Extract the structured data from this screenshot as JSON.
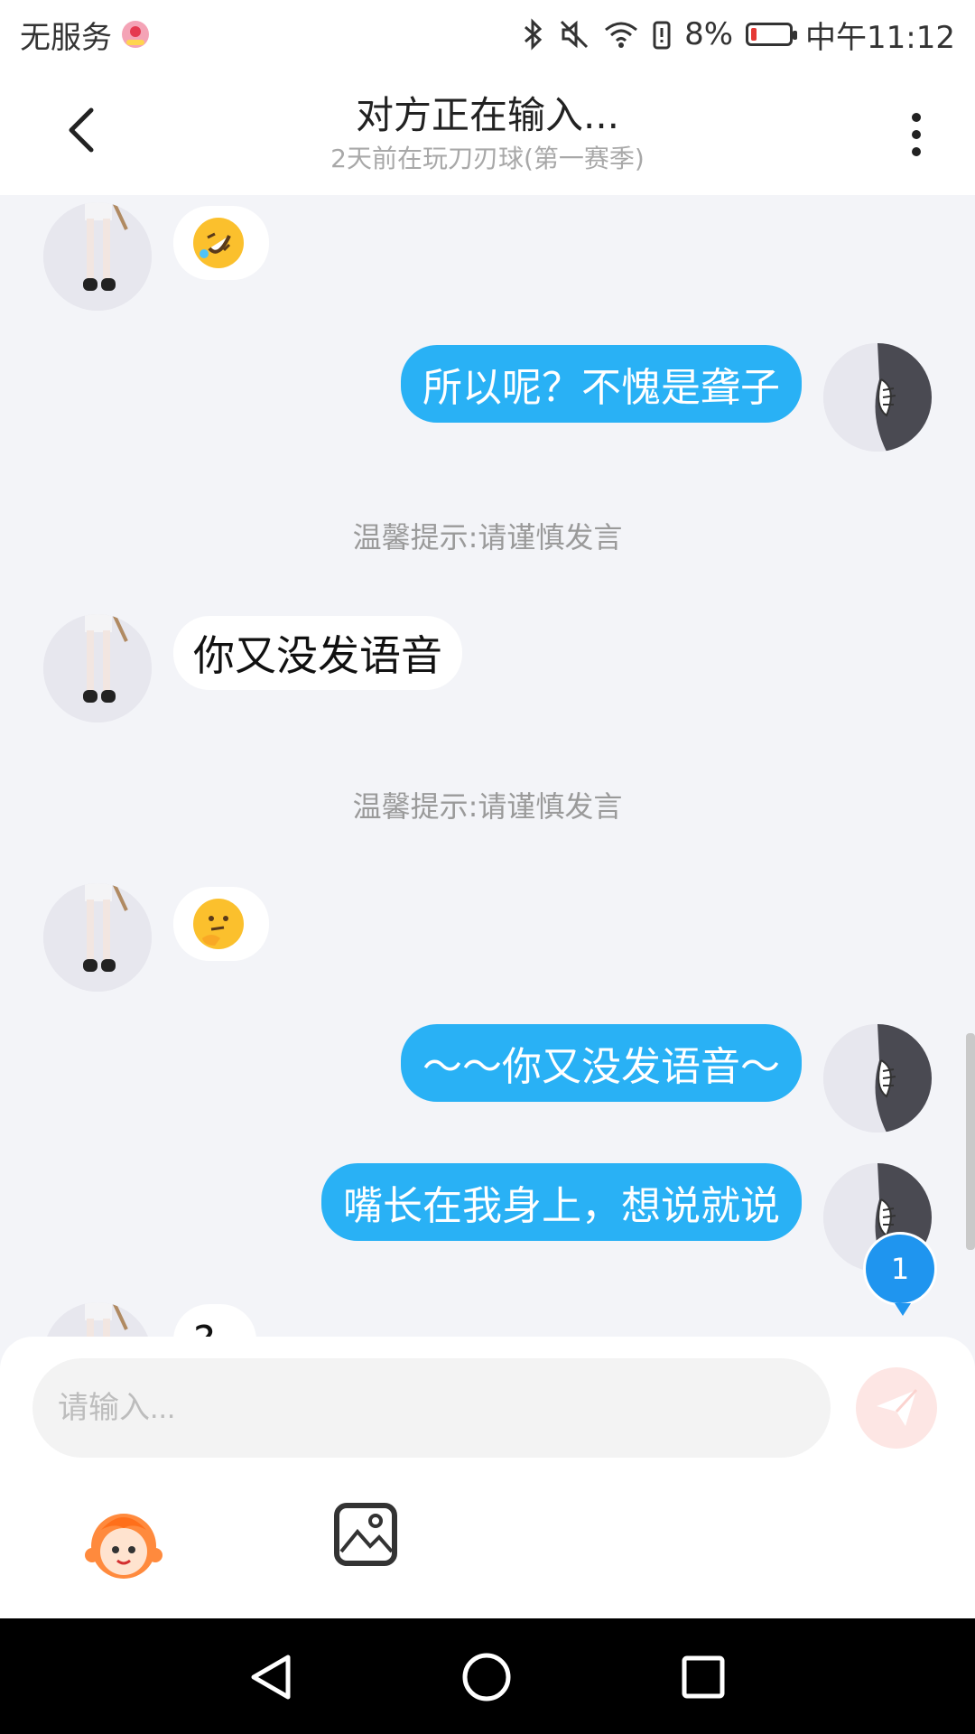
{
  "status_bar": {
    "carrier": "无服务",
    "battery_percent": "8%",
    "battery_level_fraction": 0.08,
    "time": "中午11:12",
    "battery_color": "#e53935"
  },
  "header": {
    "title": "对方正在输入...",
    "subtitle": "2天前在玩刀刃球(第一赛季)",
    "back_icon": "chevron-left-icon",
    "more_icon": "more-vertical-icon"
  },
  "messages": [
    {
      "side": "left",
      "type": "emoji",
      "emoji": "rolling-on-floor-laughing"
    },
    {
      "side": "right",
      "type": "text",
      "text": "所以呢？不愧是聋子"
    },
    {
      "side": "system",
      "type": "notice",
      "text": "温馨提示:请谨慎发言"
    },
    {
      "side": "left",
      "type": "text",
      "text": "你又没发语音"
    },
    {
      "side": "system",
      "type": "notice",
      "text": "温馨提示:请谨慎发言"
    },
    {
      "side": "left",
      "type": "emoji",
      "emoji": "thinking-face"
    },
    {
      "side": "right",
      "type": "text",
      "text": "～～你又没发语音～"
    },
    {
      "side": "right",
      "type": "text",
      "text": "嘴长在我身上，想说就说"
    },
    {
      "side": "left",
      "type": "text",
      "text": "?"
    }
  ],
  "unread_badge": "1",
  "composer": {
    "placeholder": "请输入...",
    "send_icon": "paper-plane-icon",
    "tools": [
      "emoji-mascot-icon",
      "image-icon"
    ]
  },
  "colors": {
    "accent_blue": "#29b1f5",
    "background": "#f3f4f8",
    "send_button_bg": "#fde6e4"
  }
}
